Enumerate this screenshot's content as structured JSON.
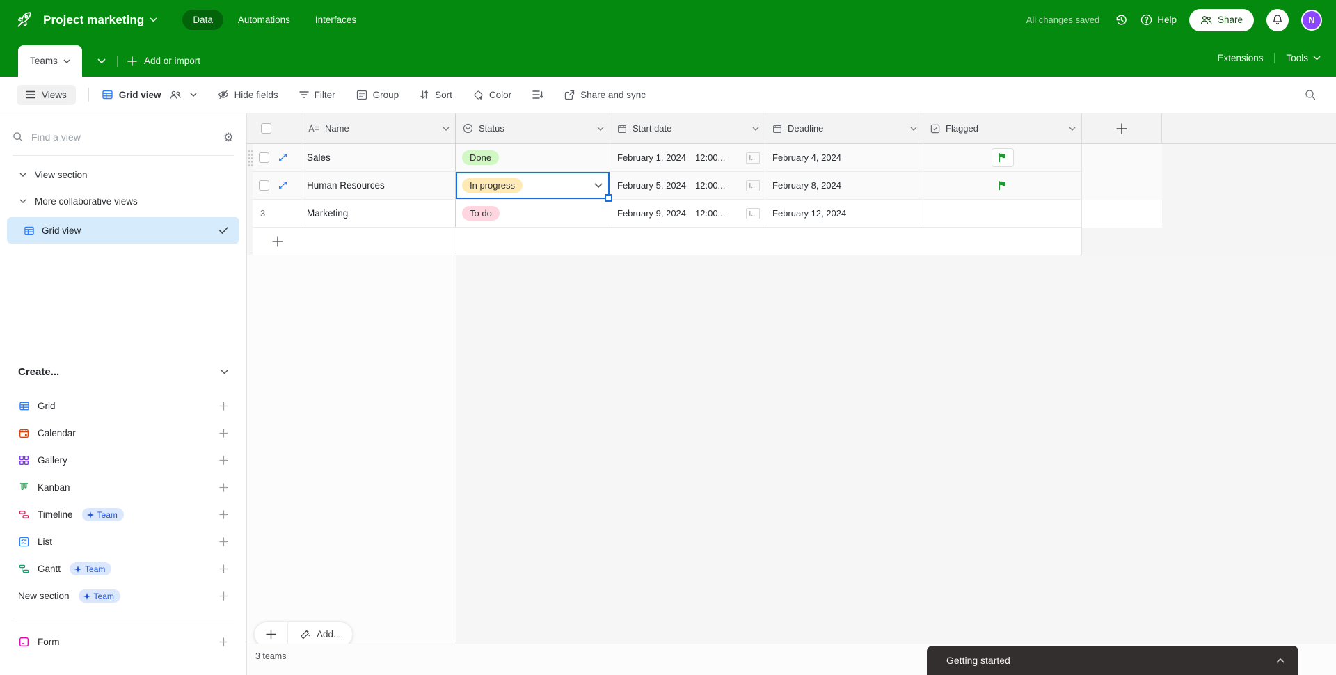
{
  "colors": {
    "brand_green": "#048a0e",
    "active_tab_overlay": "rgba(0,0,0,0.28)",
    "selection_blue": "#166ee1",
    "view_icon_blue": "#2d7ff9",
    "status_done_bg": "#d1f7c4",
    "status_in_progress_bg": "#ffeab6",
    "status_todo_bg": "#ffd6e0",
    "flag_green": "#1d9b32",
    "sidebar_selected_bg": "#d6ebfc",
    "team_badge_bg": "#dbe7fd",
    "team_badge_text": "#2457d6",
    "avatar_purple": "#8b46ff",
    "toast_bg": "#332f2e"
  },
  "topbar": {
    "title": "Project marketing",
    "tabs": [
      "Data",
      "Automations",
      "Interfaces"
    ],
    "status": "All changes saved",
    "help": "Help",
    "share": "Share",
    "avatar_initial": "N"
  },
  "tabbar": {
    "table_tab": "Teams",
    "add": "Add or import",
    "extensions": "Extensions",
    "tools": "Tools"
  },
  "toolbar": {
    "views": "Views",
    "view_name": "Grid view",
    "hide_fields": "Hide fields",
    "filter": "Filter",
    "group": "Group",
    "sort": "Sort",
    "color": "Color",
    "share_sync": "Share and sync"
  },
  "sidebar": {
    "find_placeholder": "Find a view",
    "section1": "View section",
    "section2": "More collaborative views",
    "selected_view": "Grid view",
    "create_label": "Create...",
    "create_items": [
      {
        "label": "Grid"
      },
      {
        "label": "Calendar"
      },
      {
        "label": "Gallery"
      },
      {
        "label": "Kanban"
      },
      {
        "label": "Timeline",
        "badge": "Team"
      },
      {
        "label": "List"
      },
      {
        "label": "Gantt",
        "badge": "Team"
      },
      {
        "label": "New section",
        "badge": "Team"
      },
      {
        "label": "Form"
      }
    ]
  },
  "table": {
    "columns": [
      "Name",
      "Status",
      "Start date",
      "Deadline",
      "Flagged"
    ],
    "row3_number": "3",
    "rows": [
      {
        "name": "Sales",
        "status": "Done",
        "start_date": "February 1, 2024",
        "start_time": "12:00...",
        "tz": "I...",
        "deadline": "February 4, 2024",
        "flagged": true
      },
      {
        "name": "Human Resources",
        "status": "In progress",
        "start_date": "February 5, 2024",
        "start_time": "12:00...",
        "tz": "I...",
        "deadline": "February 8, 2024",
        "flagged": true
      },
      {
        "name": "Marketing",
        "status": "To do",
        "start_date": "February 9, 2024",
        "start_time": "12:00...",
        "tz": "I...",
        "deadline": "February 12, 2024",
        "flagged": false
      }
    ]
  },
  "footer": {
    "add": "Add...",
    "summary": "3 teams"
  },
  "toast": {
    "label": "Getting started"
  }
}
